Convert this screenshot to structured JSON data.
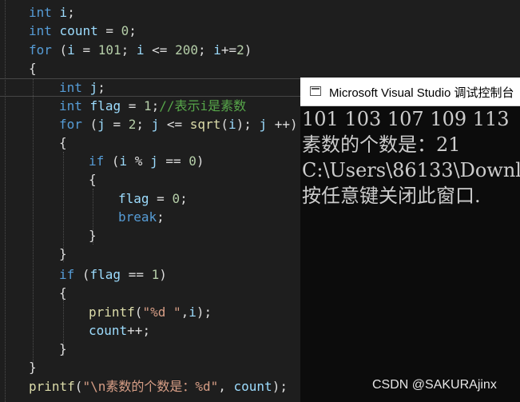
{
  "editor": {
    "lines": [
      {
        "parts": [
          {
            "t": "int",
            "c": "kw"
          },
          {
            "t": " "
          },
          {
            "t": "i",
            "c": "id"
          },
          {
            "t": ";"
          }
        ]
      },
      {
        "parts": [
          {
            "t": "int",
            "c": "kw"
          },
          {
            "t": " "
          },
          {
            "t": "count",
            "c": "id"
          },
          {
            "t": " = "
          },
          {
            "t": "0",
            "c": "num"
          },
          {
            "t": ";"
          }
        ]
      },
      {
        "parts": [
          {
            "t": "for",
            "c": "kw"
          },
          {
            "t": " ("
          },
          {
            "t": "i",
            "c": "id"
          },
          {
            "t": " = "
          },
          {
            "t": "101",
            "c": "num"
          },
          {
            "t": "; "
          },
          {
            "t": "i",
            "c": "id"
          },
          {
            "t": " <= "
          },
          {
            "t": "200",
            "c": "num"
          },
          {
            "t": "; "
          },
          {
            "t": "i",
            "c": "id"
          },
          {
            "t": "+="
          },
          {
            "t": "2",
            "c": "num"
          },
          {
            "t": ")"
          }
        ]
      },
      {
        "parts": [
          {
            "t": "{"
          }
        ]
      },
      {
        "parts": [
          {
            "t": "int",
            "c": "kw"
          },
          {
            "t": " "
          },
          {
            "t": "j",
            "c": "id"
          },
          {
            "t": ";"
          }
        ]
      },
      {
        "parts": [
          {
            "t": "int",
            "c": "kw"
          },
          {
            "t": " "
          },
          {
            "t": "flag",
            "c": "id"
          },
          {
            "t": " = "
          },
          {
            "t": "1",
            "c": "num"
          },
          {
            "t": ";"
          },
          {
            "t": "//表示i是素数",
            "c": "cmt"
          }
        ]
      },
      {
        "parts": [
          {
            "t": "for",
            "c": "kw"
          },
          {
            "t": " ("
          },
          {
            "t": "j",
            "c": "id"
          },
          {
            "t": " = "
          },
          {
            "t": "2",
            "c": "num"
          },
          {
            "t": "; "
          },
          {
            "t": "j",
            "c": "id"
          },
          {
            "t": " <= "
          },
          {
            "t": "sqrt",
            "c": "fn"
          },
          {
            "t": "("
          },
          {
            "t": "i",
            "c": "id"
          },
          {
            "t": "); "
          },
          {
            "t": "j",
            "c": "id"
          },
          {
            "t": " ++)"
          }
        ]
      },
      {
        "parts": [
          {
            "t": "{"
          }
        ]
      },
      {
        "parts": [
          {
            "t": "if",
            "c": "kw"
          },
          {
            "t": " ("
          },
          {
            "t": "i",
            "c": "id"
          },
          {
            "t": " % "
          },
          {
            "t": "j",
            "c": "id"
          },
          {
            "t": " == "
          },
          {
            "t": "0",
            "c": "num"
          },
          {
            "t": ")"
          }
        ]
      },
      {
        "parts": [
          {
            "t": "{"
          }
        ]
      },
      {
        "parts": [
          {
            "t": "flag",
            "c": "id"
          },
          {
            "t": " = "
          },
          {
            "t": "0",
            "c": "num"
          },
          {
            "t": ";"
          }
        ]
      },
      {
        "parts": [
          {
            "t": "break",
            "c": "kw"
          },
          {
            "t": ";"
          }
        ]
      },
      {
        "parts": [
          {
            "t": "}"
          }
        ]
      },
      {
        "parts": [
          {
            "t": "}"
          }
        ]
      },
      {
        "parts": [
          {
            "t": "if",
            "c": "kw"
          },
          {
            "t": " ("
          },
          {
            "t": "flag",
            "c": "id"
          },
          {
            "t": " == "
          },
          {
            "t": "1",
            "c": "num"
          },
          {
            "t": ")"
          }
        ]
      },
      {
        "parts": [
          {
            "t": "{"
          }
        ]
      },
      {
        "parts": [
          {
            "t": "printf",
            "c": "fn"
          },
          {
            "t": "("
          },
          {
            "t": "\"%d \"",
            "c": "str"
          },
          {
            "t": ","
          },
          {
            "t": "i",
            "c": "id"
          },
          {
            "t": ");"
          }
        ]
      },
      {
        "parts": [
          {
            "t": "count",
            "c": "id"
          },
          {
            "t": "++;"
          }
        ]
      },
      {
        "parts": [
          {
            "t": "}"
          }
        ]
      },
      {
        "parts": [
          {
            "t": "}"
          }
        ]
      },
      {
        "parts": [
          {
            "t": "printf",
            "c": "fn"
          },
          {
            "t": "("
          },
          {
            "t": "\"\\n素数的个数是：%d\"",
            "c": "str"
          },
          {
            "t": ", "
          },
          {
            "t": "count",
            "c": "id"
          },
          {
            "t": ");"
          }
        ]
      }
    ]
  },
  "console": {
    "title": "Microsoft Visual Studio 调试控制台",
    "output_lines": [
      "101 103 107 109 113",
      "素数的个数是：21",
      "C:\\Users\\86133\\Downl",
      "按任意键关闭此窗口."
    ]
  },
  "watermark": "CSDN @SAKURAjinx"
}
